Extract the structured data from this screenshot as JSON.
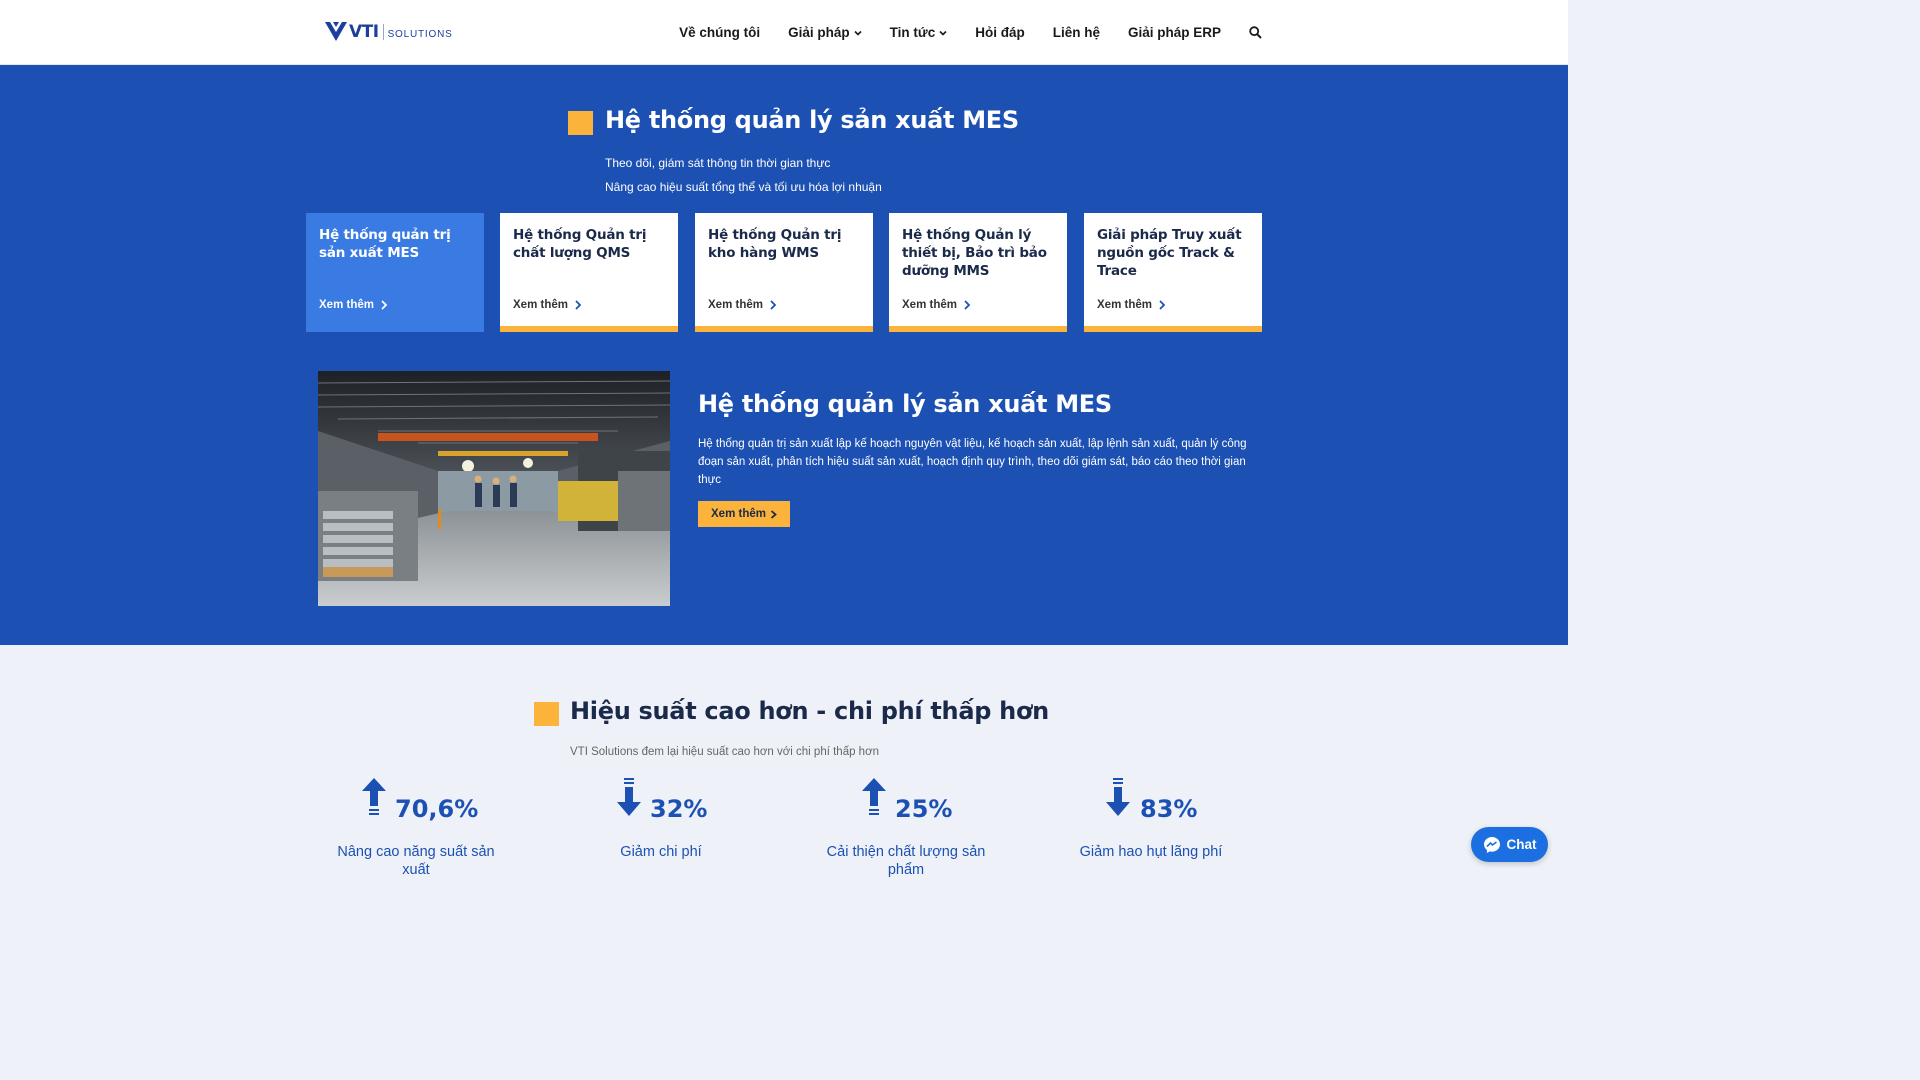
{
  "header": {
    "logo_text": "VTI",
    "logo_sub": "SOLUTIONS",
    "nav": [
      {
        "label": "Về chúng tôi",
        "dropdown": false
      },
      {
        "label": "Giải pháp",
        "dropdown": true
      },
      {
        "label": "Tin tức",
        "dropdown": true
      },
      {
        "label": "Hỏi đáp",
        "dropdown": false
      },
      {
        "label": "Liên hệ",
        "dropdown": false
      },
      {
        "label": "Giải pháp ERP",
        "dropdown": false
      }
    ],
    "search_icon": "search-icon"
  },
  "hero": {
    "title": "Hệ thống quản lý sản xuất MES",
    "subtitle_1": "Theo dõi, giám sát thông tin thời gian thực",
    "subtitle_2": "Nâng cao hiệu suất tổng thể và tối ưu hóa lợi nhuận"
  },
  "cards": [
    {
      "title": "Hệ thống quản trị sản xuất MES",
      "more": "Xem thêm",
      "active": true
    },
    {
      "title": "Hệ thống Quản trị chất lượng QMS",
      "more": "Xem thêm",
      "active": false
    },
    {
      "title": "Hệ thống Quản trị kho hàng WMS",
      "more": "Xem thêm",
      "active": false
    },
    {
      "title": "Hệ thống Quản lý thiết bị, Bảo trì bảo dưỡng MMS",
      "more": "Xem thêm",
      "active": false
    },
    {
      "title": "Giải pháp Truy xuất nguồn gốc Track & Trace",
      "more": "Xem thêm",
      "active": false
    }
  ],
  "feature": {
    "title": "Hệ thống quản lý sản xuất MES",
    "description": "Hệ thống quản trị sản xuất lập kế hoạch nguyên vật liệu, kế hoạch sản xuất, lập lệnh sản xuất, quản lý công đoạn sản xuất, phân tích hiệu suất sản xuất, hoạch định quy trình, theo dõi giám sát, báo cáo theo thời gian thực",
    "button": "Xem thêm"
  },
  "stats": {
    "title": "Hiệu suất cao hơn - chi phí thấp hơn",
    "subtitle": "VTI Solutions đem lại hiệu suất cao hơn với chi phí thấp hơn",
    "items": [
      {
        "value": "70,6%",
        "label": "Nâng cao năng suất sản xuất",
        "direction": "up"
      },
      {
        "value": "32%",
        "label": "Giảm chi phí",
        "direction": "down"
      },
      {
        "value": "25%",
        "label": "Cải thiện chất lượng sản phẩm",
        "direction": "up"
      },
      {
        "value": "83%",
        "label": "Giảm hao hụt lãng phí",
        "direction": "down"
      }
    ]
  },
  "chat": {
    "label": "Chat"
  },
  "colors": {
    "primary": "#1c50b3",
    "accent": "#fbb33c",
    "active_card": "#3a7ae3"
  }
}
